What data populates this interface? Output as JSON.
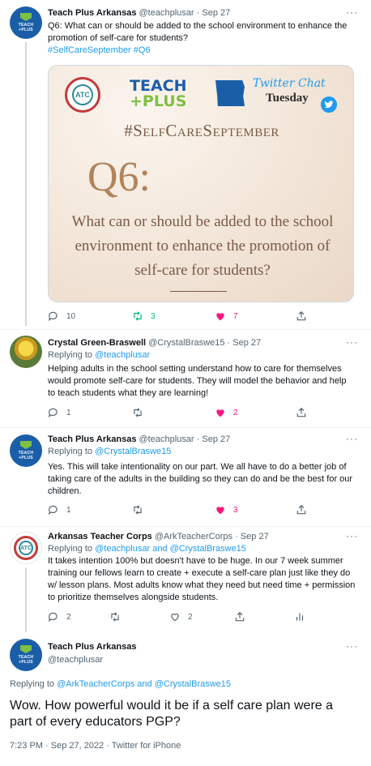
{
  "tweets": [
    {
      "name": "Teach Plus Arkansas",
      "handle": "@teachplusar",
      "time": "Sep 27",
      "text": "Q6: What can or should be added to the school environment to enhance the promotion of self-care for students?",
      "hashtags": "#SelfCareSeptember #Q6",
      "counts": {
        "replies": "10",
        "retweets": "3",
        "likes": "7"
      }
    },
    {
      "name": "Crystal Green-Braswell",
      "handle": "@CrystalBraswe15",
      "time": "Sep 27",
      "replying_prefix": "Replying to",
      "replying_to": "@teachplusar",
      "text": "Helping adults in the school setting understand how to care for themselves would promote self-care for students.  They will model the behavior and help to teach students what they are learning!",
      "counts": {
        "replies": "1",
        "retweets": "",
        "likes": "2"
      }
    },
    {
      "name": "Teach Plus Arkansas",
      "handle": "@teachplusar",
      "time": "Sep 27",
      "replying_prefix": "Replying to",
      "replying_to": "@CrystalBraswe15",
      "text": "Yes. This will take intentionality on our part. We all have to do a better job of taking care of the adults in the building so they can do and be the best for our children.",
      "counts": {
        "replies": "1",
        "retweets": "",
        "likes": "3"
      }
    },
    {
      "name": "Arkansas Teacher Corps",
      "handle": "@ArkTeacherCorps",
      "time": "Sep 27",
      "replying_prefix": "Replying to",
      "replying_to": "@teachplusar and @CrystalBraswe15",
      "text": "It takes intention 100% but doesn't have to be huge. In our 7 week summer training our fellows learn to create + execute a self-care plan just like they do w/ lesson plans. Most adults know what they need but need time + permission to prioritize themselves alongside students.",
      "counts": {
        "replies": "2",
        "retweets": "",
        "likes": "2"
      }
    }
  ],
  "media": {
    "brand_line1": "TEACH",
    "brand_line2": "+PLUS",
    "chat_line1": "Twitter Chat",
    "chat_line2": "Tuesday",
    "hashtag": "#SelfCareSeptember",
    "question_number": "Q6:",
    "question_text": "What can or should be added to the school environment to enhance the promotion of self-care for students?"
  },
  "focused": {
    "name": "Teach Plus Arkansas",
    "handle": "@teachplusar",
    "replying_prefix": "Replying to",
    "replying_to": "@ArkTeacherCorps and @CrystalBraswe15",
    "text": "Wow. How powerful would it be if a self care plan were a part of every educators PGP?",
    "meta": "7:23 PM · Sep 27, 2022 · Twitter for iPhone"
  },
  "ui": {
    "more": "···",
    "dot": "·"
  },
  "colors": {
    "link": "#1d9bf0",
    "like": "#f91880",
    "retweet": "#00ba7c",
    "muted": "#536471"
  }
}
